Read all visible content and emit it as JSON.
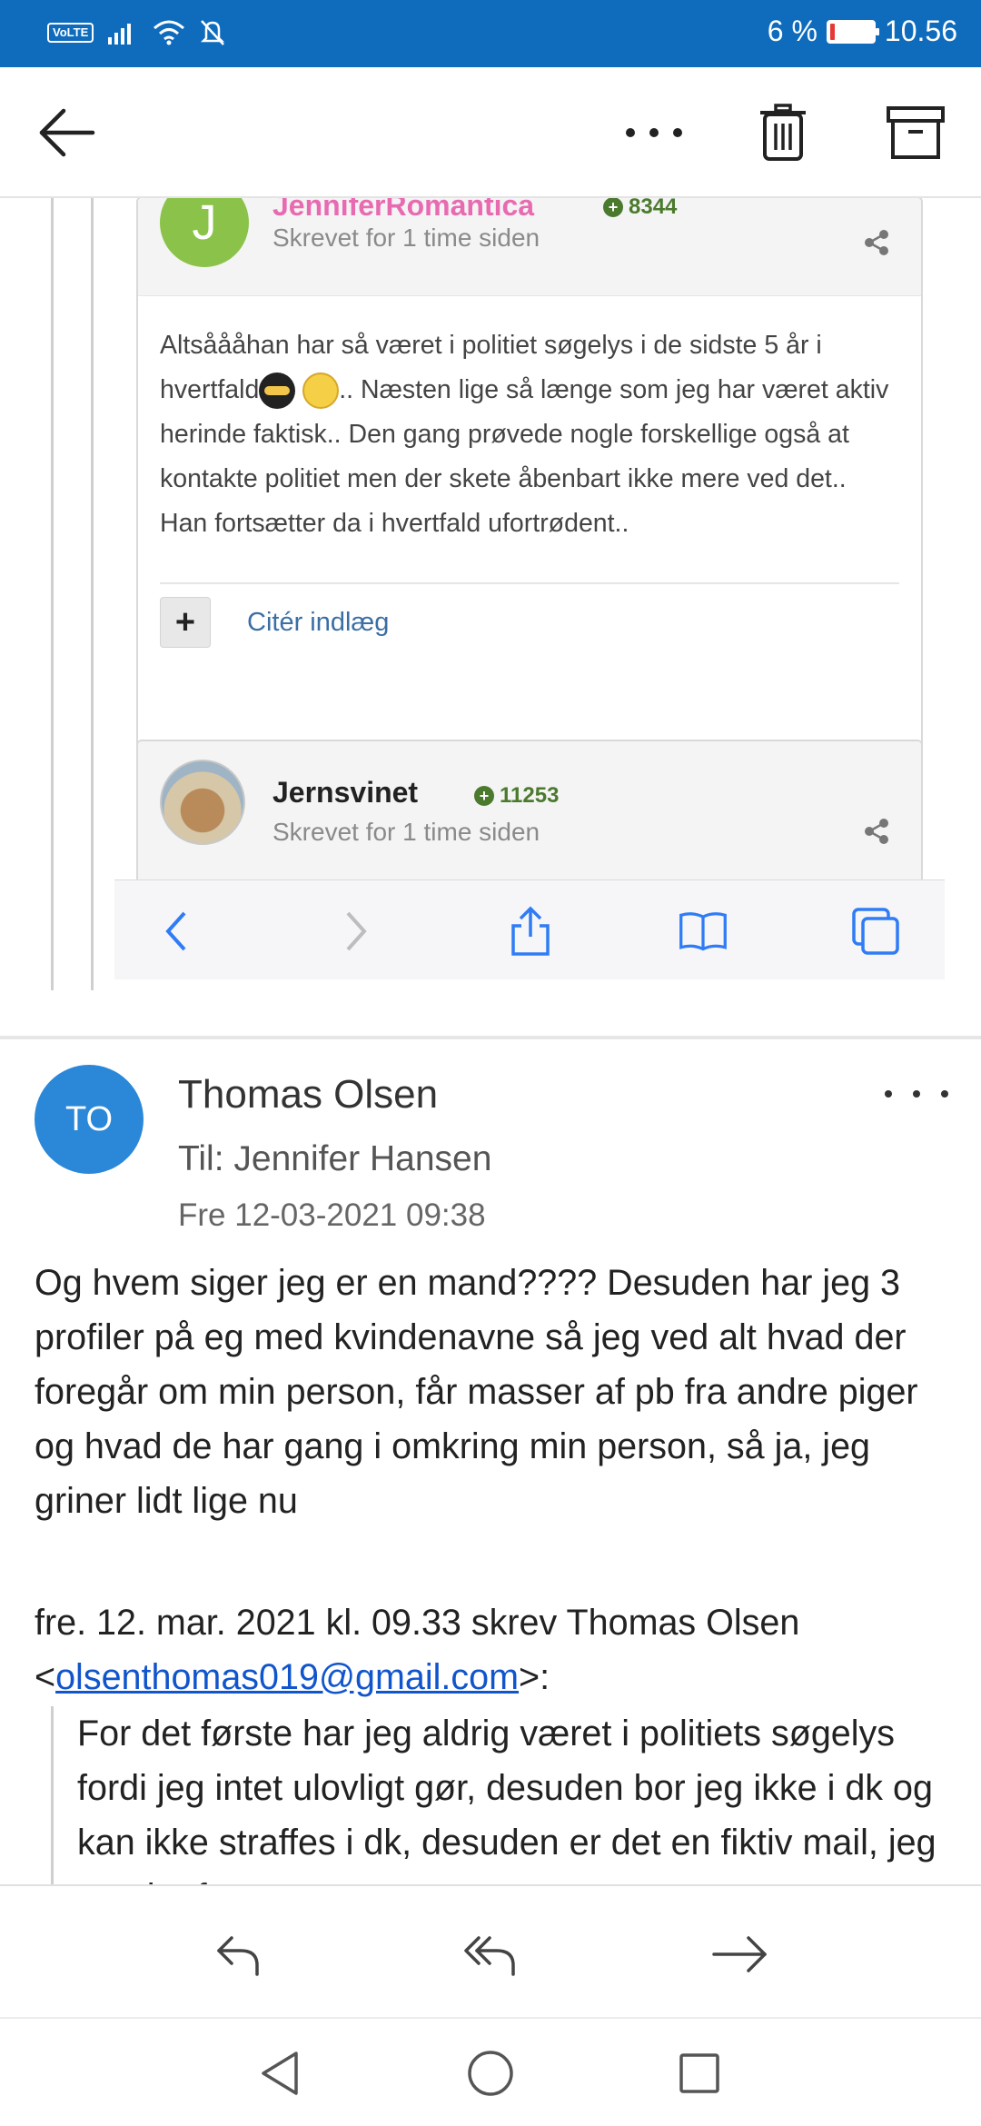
{
  "status_bar": {
    "volte": "VoLTE",
    "battery_percent": "6 %",
    "battery_level": 0.06,
    "battery_color": "#e53935",
    "time": "10.56",
    "background": "#0f6cbd"
  },
  "toolbar": {
    "back_icon": "arrow-left-icon",
    "more_icon": "more-horizontal-icon",
    "delete_icon": "trash-icon",
    "archive_icon": "archive-icon"
  },
  "embedded_posts": {
    "post1": {
      "avatar_letter": "J",
      "author": "JenniferRomantica",
      "score": "8344",
      "time": "Skrevet for 1 time siden",
      "body_part1": "Altsåååhan har så været i politiet søgelys i de sidste 5 år i hvertfald",
      "body_part2": ".. Næsten lige så længe som jeg har været aktiv herinde faktisk.. Den gang prøvede nogle forskellige også at kontakte politiet men der skete åbenbart ikke mere ved det.. Han fortsætter da i hvertfald ufortrødent..",
      "cite_plus": "+",
      "cite_label": "Citér indlæg"
    },
    "post2": {
      "author": "Jernsvinet",
      "score": "11253",
      "time": "Skrevet for 1 time siden"
    }
  },
  "message": {
    "avatar_initials": "TO",
    "avatar_color": "#2b88d8",
    "from": "Thomas Olsen",
    "to": "Til: Jennifer Hansen",
    "date": "Fre 12-03-2021 09:38",
    "body": "Og hvem siger jeg er en mand???? Desuden har jeg 3 profiler på eg med kvindenavne så jeg ved alt hvad der foregår om min person, får masser af pb fra andre piger og hvad de har gang i omkring min person, så ja, jeg griner lidt lige nu",
    "quote_intro": "fre. 12. mar. 2021 kl. 09.33 skrev Thomas Olsen",
    "quote_lt": "<",
    "quote_email": "olsenthomas019@gmail.com",
    "quote_gt": ">:",
    "quoted_text": "For det første har jeg aldrig været i politiets søgelys fordi jeg intet ulovligt gør, desuden bor jeg ikke i dk og kan ikke straffes i dk, desuden er det en fiktiv mail, jeg sender fra en app over"
  },
  "actions": {
    "reply_icon": "reply-icon",
    "reply_all_icon": "reply-all-icon",
    "forward_icon": "forward-icon"
  },
  "nav": {
    "back": "nav-back-icon",
    "home": "nav-home-icon",
    "recents": "nav-recents-icon"
  }
}
